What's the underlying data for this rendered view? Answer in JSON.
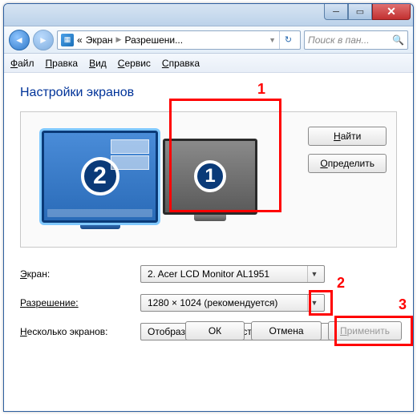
{
  "titlebar": {
    "minimize": "─",
    "maximize": "▭",
    "close": "✕"
  },
  "nav": {
    "breadcrumb_root": "«",
    "breadcrumb_1": "Экран",
    "breadcrumb_2": "Разрешени...",
    "search_placeholder": "Поиск в пан..."
  },
  "menu": {
    "file": "айл",
    "file_u": "Ф",
    "edit": "равка",
    "edit_u": "П",
    "view": "ид",
    "view_u": "В",
    "tools": "ервис",
    "tools_u": "С",
    "help": "правка",
    "help_u": "С"
  },
  "page": {
    "heading": "Настройки экранов",
    "monitor1_num": "1",
    "monitor2_num": "2",
    "find_btn_u": "Н",
    "find_btn": "айти",
    "detect_btn_u": "О",
    "detect_btn": "пределить"
  },
  "form": {
    "screen_label_u": "Э",
    "screen_label": "кран:",
    "screen_value": "2. Acer LCD Monitor AL1951",
    "res_label_u": "Р",
    "res_label": "азрешение:",
    "res_value": "1280 × 1024 (рекомендуется)",
    "multi_label_u": "Н",
    "multi_label": "есколько экранов:",
    "multi_value": "Отобразить рабочий стол только на 2"
  },
  "footer": {
    "ok": "ОК",
    "cancel": "Отмена",
    "apply_u": "П",
    "apply": "рименить"
  },
  "annotations": {
    "a1": "1",
    "a2": "2",
    "a3": "3"
  }
}
